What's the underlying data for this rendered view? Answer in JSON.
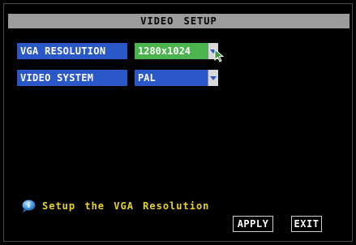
{
  "title": "VIDEO  SETUP",
  "rows": [
    {
      "label": "VGA RESOLUTION",
      "value": "1280x1024"
    },
    {
      "label": "VIDEO SYSTEM",
      "value": "PAL"
    }
  ],
  "info": {
    "text": "Setup the VGA Resolution",
    "icon": "info-bubble-icon"
  },
  "buttons": {
    "apply": "APPLY",
    "exit": "EXIT"
  },
  "colors": {
    "label_bg": "#2b58c8",
    "selected_bg": "#4cb44c",
    "title_bg": "#9c9c9c",
    "info_text": "#e8d320"
  }
}
